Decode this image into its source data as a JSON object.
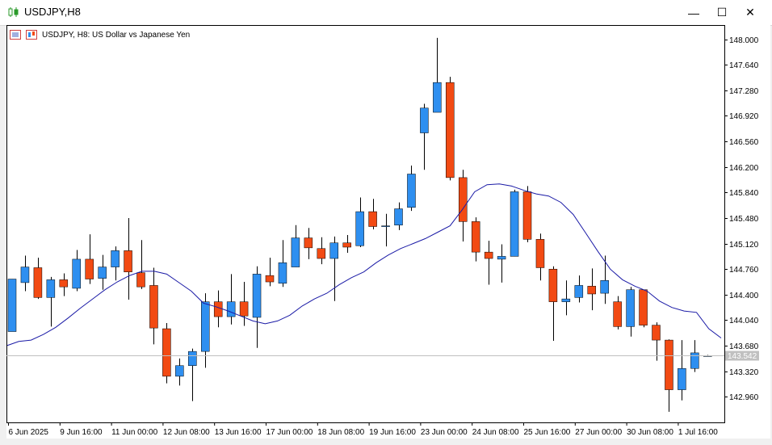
{
  "window": {
    "title": "USDJPY,H8",
    "minimize_glyph": "—",
    "maximize_glyph": "☐",
    "close_glyph": "✕"
  },
  "chart_header": {
    "caption": "USDJPY, H8:  US Dollar vs Japanese Yen"
  },
  "colors": {
    "bull": "#2e8ff0",
    "bear": "#f24a13",
    "ma_line": "#1a1aa6",
    "grid": "#c0c0c0",
    "axis": "#000000",
    "price_line": "#c0c0c0",
    "price_tag": "#c0c0c0"
  },
  "chart_data": {
    "type": "candlestick",
    "symbol": "USDJPY",
    "timeframe": "H8",
    "ylim": [
      142.6,
      148.2
    ],
    "y_ticks": [
      "148.000",
      "147.640",
      "147.280",
      "146.920",
      "146.560",
      "146.200",
      "145.840",
      "145.480",
      "145.120",
      "144.760",
      "144.400",
      "144.040",
      "143.680",
      "143.320",
      "142.960"
    ],
    "x_ticks": [
      "6 Jun 2025",
      "9 Jun 16:00",
      "11 Jun 00:00",
      "12 Jun 08:00",
      "13 Jun 16:00",
      "17 Jun 00:00",
      "18 Jun 08:00",
      "19 Jun 16:00",
      "23 Jun 00:00",
      "24 Jun 08:00",
      "25 Jun 16:00",
      "27 Jun 00:00",
      "30 Jun 08:00",
      "1 Jul 16:00"
    ],
    "current_price": "143.542",
    "candles": [
      {
        "o": 143.88,
        "h": 144.62,
        "l": 143.88,
        "c": 144.62
      },
      {
        "o": 144.57,
        "h": 144.95,
        "l": 144.45,
        "c": 144.79
      },
      {
        "o": 144.78,
        "h": 144.92,
        "l": 144.34,
        "c": 144.36
      },
      {
        "o": 144.36,
        "h": 144.65,
        "l": 143.95,
        "c": 144.61
      },
      {
        "o": 144.61,
        "h": 144.7,
        "l": 144.38,
        "c": 144.51
      },
      {
        "o": 144.49,
        "h": 145.03,
        "l": 144.45,
        "c": 144.9
      },
      {
        "o": 144.9,
        "h": 145.25,
        "l": 144.55,
        "c": 144.62
      },
      {
        "o": 144.63,
        "h": 144.96,
        "l": 144.47,
        "c": 144.79
      },
      {
        "o": 144.79,
        "h": 145.08,
        "l": 144.6,
        "c": 145.02
      },
      {
        "o": 145.02,
        "h": 145.48,
        "l": 144.33,
        "c": 144.72
      },
      {
        "o": 144.71,
        "h": 145.17,
        "l": 144.48,
        "c": 144.51
      },
      {
        "o": 144.53,
        "h": 144.78,
        "l": 143.7,
        "c": 143.93
      },
      {
        "o": 143.92,
        "h": 144.0,
        "l": 143.15,
        "c": 143.25
      },
      {
        "o": 143.25,
        "h": 143.5,
        "l": 143.12,
        "c": 143.4
      },
      {
        "o": 143.4,
        "h": 143.64,
        "l": 142.9,
        "c": 143.6
      },
      {
        "o": 143.6,
        "h": 144.42,
        "l": 143.37,
        "c": 144.3
      },
      {
        "o": 144.3,
        "h": 144.46,
        "l": 143.94,
        "c": 144.09
      },
      {
        "o": 144.09,
        "h": 144.69,
        "l": 143.98,
        "c": 144.3
      },
      {
        "o": 144.3,
        "h": 144.58,
        "l": 143.96,
        "c": 144.1
      },
      {
        "o": 144.08,
        "h": 144.8,
        "l": 143.65,
        "c": 144.69
      },
      {
        "o": 144.67,
        "h": 144.92,
        "l": 144.52,
        "c": 144.58
      },
      {
        "o": 144.56,
        "h": 145.17,
        "l": 144.51,
        "c": 144.85
      },
      {
        "o": 144.79,
        "h": 145.38,
        "l": 144.79,
        "c": 145.2
      },
      {
        "o": 145.2,
        "h": 145.34,
        "l": 144.9,
        "c": 145.06
      },
      {
        "o": 145.05,
        "h": 145.21,
        "l": 144.83,
        "c": 144.91
      },
      {
        "o": 144.91,
        "h": 145.22,
        "l": 144.31,
        "c": 145.13
      },
      {
        "o": 145.13,
        "h": 145.24,
        "l": 144.99,
        "c": 145.07
      },
      {
        "o": 145.09,
        "h": 145.77,
        "l": 145.07,
        "c": 145.57
      },
      {
        "o": 145.57,
        "h": 145.75,
        "l": 145.32,
        "c": 145.36
      },
      {
        "o": 145.36,
        "h": 145.54,
        "l": 145.08,
        "c": 145.37
      },
      {
        "o": 145.38,
        "h": 145.7,
        "l": 145.31,
        "c": 145.61
      },
      {
        "o": 145.63,
        "h": 146.22,
        "l": 145.58,
        "c": 146.1
      },
      {
        "o": 146.68,
        "h": 147.09,
        "l": 146.16,
        "c": 147.03
      },
      {
        "o": 146.97,
        "h": 148.02,
        "l": 146.98,
        "c": 147.39
      },
      {
        "o": 147.39,
        "h": 147.47,
        "l": 146.01,
        "c": 146.05
      },
      {
        "o": 146.05,
        "h": 146.16,
        "l": 145.15,
        "c": 145.43
      },
      {
        "o": 145.43,
        "h": 145.49,
        "l": 144.87,
        "c": 145.0
      },
      {
        "o": 145.0,
        "h": 145.16,
        "l": 144.54,
        "c": 144.91
      },
      {
        "o": 144.9,
        "h": 145.11,
        "l": 144.57,
        "c": 144.94
      },
      {
        "o": 144.94,
        "h": 145.88,
        "l": 144.94,
        "c": 145.85
      },
      {
        "o": 145.85,
        "h": 145.93,
        "l": 145.14,
        "c": 145.18
      },
      {
        "o": 145.18,
        "h": 145.26,
        "l": 144.6,
        "c": 144.78
      },
      {
        "o": 144.76,
        "h": 144.8,
        "l": 143.75,
        "c": 144.3
      },
      {
        "o": 144.3,
        "h": 144.6,
        "l": 144.11,
        "c": 144.34
      },
      {
        "o": 144.36,
        "h": 144.67,
        "l": 144.29,
        "c": 144.53
      },
      {
        "o": 144.52,
        "h": 144.77,
        "l": 144.18,
        "c": 144.41
      },
      {
        "o": 144.42,
        "h": 144.95,
        "l": 144.27,
        "c": 144.6
      },
      {
        "o": 144.3,
        "h": 144.38,
        "l": 143.91,
        "c": 143.95
      },
      {
        "o": 143.95,
        "h": 144.51,
        "l": 143.81,
        "c": 144.47
      },
      {
        "o": 144.47,
        "h": 144.47,
        "l": 143.94,
        "c": 143.97
      },
      {
        "o": 143.97,
        "h": 144.01,
        "l": 143.47,
        "c": 143.76
      },
      {
        "o": 143.76,
        "h": 143.77,
        "l": 142.75,
        "c": 143.06
      },
      {
        "o": 143.06,
        "h": 143.76,
        "l": 142.91,
        "c": 143.36
      },
      {
        "o": 143.36,
        "h": 143.76,
        "l": 143.31,
        "c": 143.58
      },
      {
        "o": 143.54,
        "h": 143.55,
        "l": 143.53,
        "c": 143.54
      }
    ],
    "ma": [
      143.68,
      143.74,
      143.76,
      143.84,
      143.94,
      144.07,
      144.21,
      144.34,
      144.47,
      144.58,
      144.67,
      144.73,
      144.73,
      144.69,
      144.57,
      144.45,
      144.28,
      144.23,
      144.17,
      144.1,
      144.03,
      143.99,
      144.03,
      144.11,
      144.24,
      144.34,
      144.42,
      144.54,
      144.64,
      144.72,
      144.85,
      144.96,
      145.05,
      145.12,
      145.19,
      145.28,
      145.37,
      145.6,
      145.85,
      145.95,
      145.96,
      145.93,
      145.87,
      145.82,
      145.79,
      145.7,
      145.53,
      145.27,
      145.01,
      144.76,
      144.61,
      144.52,
      144.45,
      144.31,
      144.22,
      144.17,
      144.15,
      143.92,
      143.79
    ]
  }
}
